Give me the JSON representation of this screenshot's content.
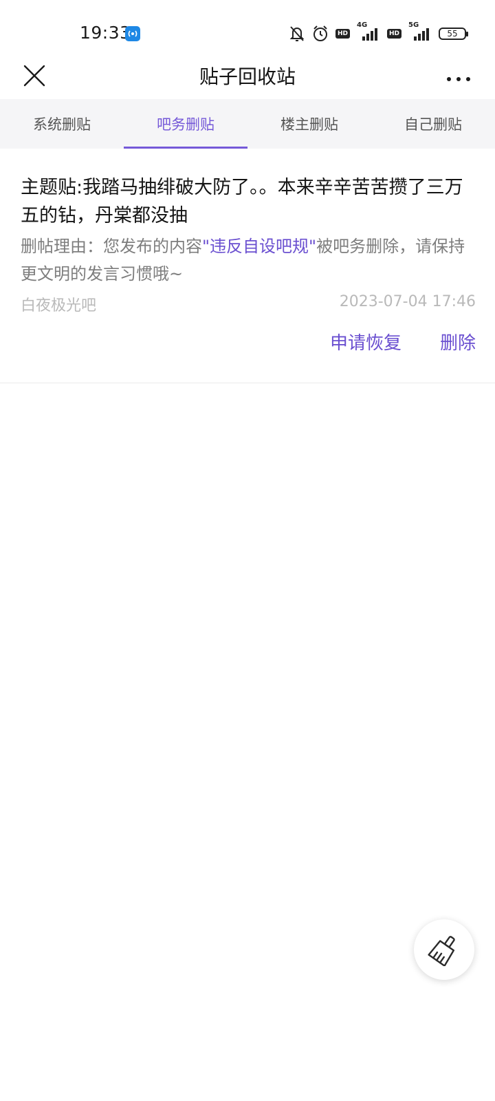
{
  "status_bar": {
    "time": "19:33",
    "icons": [
      "hotspot-icon",
      "mute-bell-icon",
      "alarm-icon",
      "hd-icon",
      "signal-4g-icon",
      "hd-icon",
      "signal-5g-icon",
      "battery-icon"
    ],
    "hd_label": "HD",
    "net1": "4G",
    "net2": "5G",
    "battery": "55"
  },
  "nav": {
    "title": "贴子回收站",
    "close_icon": "close-icon",
    "more_icon": "more-icon"
  },
  "tabs": [
    {
      "label": "系统删贴",
      "active": false
    },
    {
      "label": "吧务删贴",
      "active": true
    },
    {
      "label": "楼主删贴",
      "active": false
    },
    {
      "label": "自己删贴",
      "active": false
    }
  ],
  "post": {
    "title": "主题贴:我踏马抽绯破大防了。。本来辛辛苦苦攒了三万五的钻，丹棠都没抽",
    "reason_prefix": "删帖理由：您发布的内容",
    "reason_rule": "\"违反自设吧规\"",
    "reason_suffix": "被吧务删除，请保持更文明的发言习惯哦~",
    "forum": "白夜极光吧",
    "timestamp": "2023-07-04 17:46",
    "restore_label": "申请恢复",
    "delete_label": "删除"
  },
  "fab": {
    "icon": "broom-icon"
  },
  "colors": {
    "accent": "#7559d8",
    "tab_bg": "#f5f5f7",
    "muted_text": "#7d7d7d",
    "faint_text": "#b9b9b9"
  }
}
